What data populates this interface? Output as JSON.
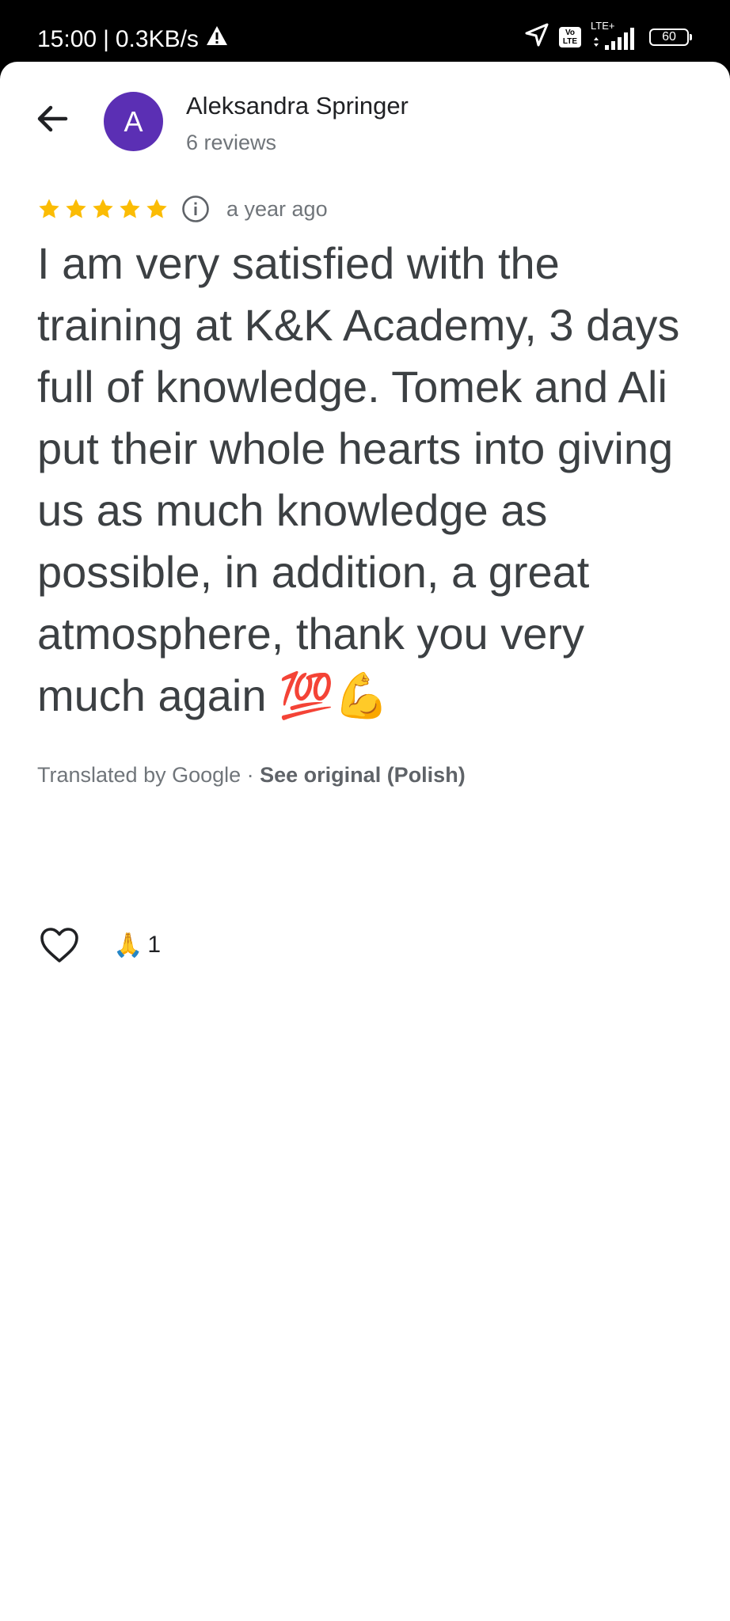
{
  "status_bar": {
    "time": "15:00",
    "separator": "|",
    "speed": "0.3KB/s",
    "volte_top": "Vo",
    "volte_bottom": "LTE",
    "network": "LTE+",
    "battery": "60"
  },
  "header": {
    "back_icon": "arrow-back-icon",
    "avatar_letter": "A",
    "avatar_color": "#5b2fb4",
    "author_name": "Aleksandra Springer",
    "author_reviews": "6 reviews"
  },
  "review": {
    "rating": 5,
    "max_rating": 5,
    "star_color": "#fbbc04",
    "time": "a year ago",
    "text": "I am very satisfied with the training at K&K Academy, 3 days full of knowledge. Tomek and Ali put their whole hearts into giving us as much knowledge as possible, in addition, a great atmosphere, thank you very much again 💯💪",
    "translated_by": "Translated by Google · ",
    "see_original": "See original (Polish)"
  },
  "reactions": {
    "like_icon": "heart-outline-icon",
    "emoji": "🙏",
    "count": "1"
  }
}
